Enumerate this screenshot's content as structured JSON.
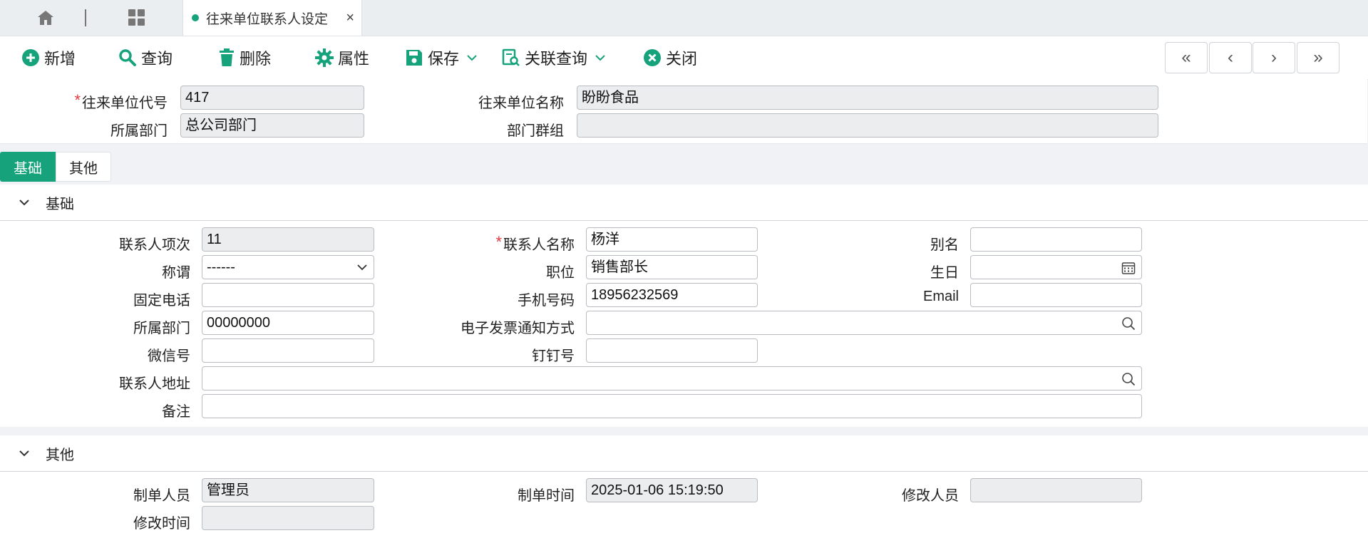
{
  "tabs": {
    "doc_title": "往来单位联系人设定",
    "close_glyph": "×"
  },
  "toolbar": {
    "add": "新增",
    "query": "查询",
    "delete": "删除",
    "properties": "属性",
    "save": "保存",
    "related_query": "关联查询",
    "close": "关闭",
    "nav_first": "«",
    "nav_prev": "‹",
    "nav_next": "›",
    "nav_last": "»"
  },
  "header": {
    "unit_code_label": "往来单位代号",
    "unit_code_value": "417",
    "unit_name_label": "往来单位名称",
    "unit_name_value": "盼盼食品",
    "dept_label": "所属部门",
    "dept_value": "总公司部门",
    "dept_group_label": "部门群组",
    "dept_group_value": ""
  },
  "section_tabs": {
    "base": "基础",
    "other": "其他"
  },
  "base": {
    "title": "基础",
    "contact_seq_label": "联系人项次",
    "contact_seq_value": "11",
    "contact_name_label": "联系人名称",
    "contact_name_value": "杨洋",
    "alias_label": "别名",
    "alias_value": "",
    "salutation_label": "称谓",
    "salutation_value": "------",
    "position_label": "职位",
    "position_value": "销售部长",
    "birthday_label": "生日",
    "birthday_value": "",
    "phone_label": "固定电话",
    "phone_value": "",
    "mobile_label": "手机号码",
    "mobile_value": "18956232569",
    "email_label": "Email",
    "email_value": "",
    "dept_label": "所属部门",
    "dept_value": "00000000",
    "einvoice_label": "电子发票通知方式",
    "einvoice_value": "",
    "wechat_label": "微信号",
    "wechat_value": "",
    "dingtalk_label": "钉钉号",
    "dingtalk_value": "",
    "address_label": "联系人地址",
    "address_value": "",
    "remark_label": "备注",
    "remark_value": ""
  },
  "other": {
    "title": "其他",
    "creator_label": "制单人员",
    "creator_value": "管理员",
    "created_time_label": "制单时间",
    "created_time_value": "2025-01-06 15:19:50",
    "modifier_label": "修改人员",
    "modifier_value": "",
    "modified_time_label": "修改时间",
    "modified_time_value": ""
  },
  "colors": {
    "accent": "#16a37b",
    "required": "#e0393e",
    "readonly_bg": "#ebedef"
  }
}
